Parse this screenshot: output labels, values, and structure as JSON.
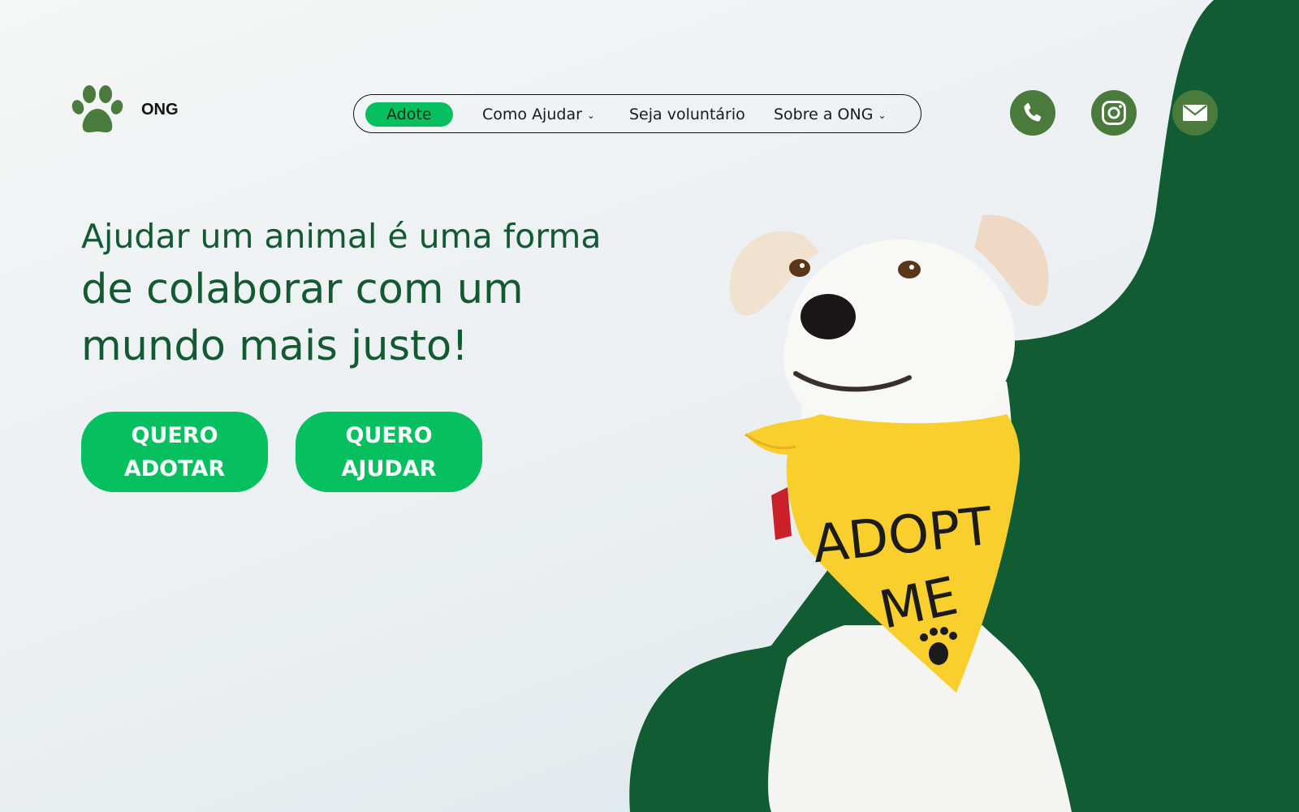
{
  "brand": {
    "name": "ONG",
    "logo_icon": "paw-icon",
    "color": "#4a7a3c"
  },
  "nav": {
    "items": [
      {
        "label": "Adote",
        "active": true
      },
      {
        "label": "Como Ajudar",
        "dropdown": true
      },
      {
        "label": "Seja voluntário"
      },
      {
        "label": "Sobre a ONG",
        "dropdown": true
      }
    ],
    "chevron": "⌄"
  },
  "social": [
    {
      "icon": "phone-icon"
    },
    {
      "icon": "instagram-icon"
    },
    {
      "icon": "mail-icon"
    }
  ],
  "hero": {
    "line1": "Ajudar um animal é uma forma",
    "line2": "de colaborar com um",
    "line3": "mundo mais justo!",
    "buttons": [
      {
        "line1": "QUERO",
        "line2": "ADOTAR"
      },
      {
        "line1": "QUERO",
        "line2": "AJUDAR"
      }
    ]
  },
  "image": {
    "bandana_text_1": "ADOPT",
    "bandana_text_2": "ME"
  },
  "colors": {
    "dark_green": "#135a33",
    "accent_green": "#06bf5f",
    "bandana_yellow": "#f9cf2d"
  }
}
